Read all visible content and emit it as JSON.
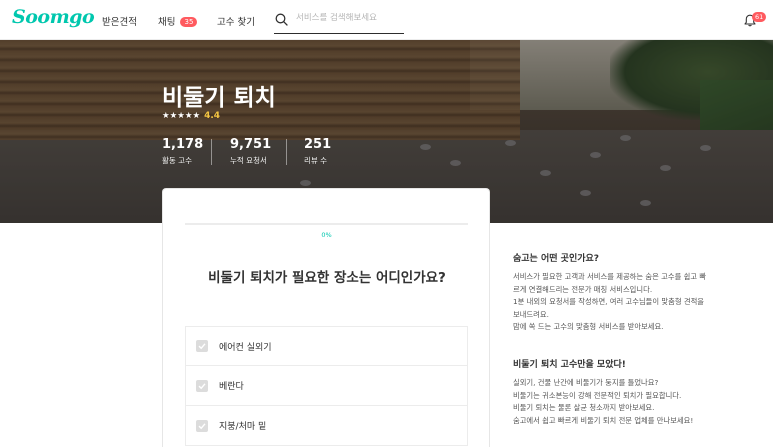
{
  "header": {
    "logo": "Soomgo",
    "nav": [
      {
        "label": "받은견적"
      },
      {
        "label": "채팅",
        "badge": "35"
      },
      {
        "label": "고수 찾기"
      }
    ],
    "search_placeholder": "서비스를 검색해보세요",
    "notification_badge": "61"
  },
  "hero": {
    "title": "비둘기 퇴치",
    "stars": "★★★★★",
    "rating": "4.4",
    "stats": [
      {
        "value": "1,178",
        "label": "활동 고수"
      },
      {
        "value": "9,751",
        "label": "누적 요청서"
      },
      {
        "value": "251",
        "label": "리뷰 수"
      }
    ]
  },
  "questionnaire": {
    "progress": 0,
    "progress_label": "0%",
    "question": "비둘기 퇴치가 필요한 장소는 어디인가요?",
    "options": [
      {
        "label": "에어컨 실외기"
      },
      {
        "label": "베란다"
      },
      {
        "label": "지붕/처마 밑"
      }
    ]
  },
  "info": {
    "section1": {
      "title": "숨고는 어떤 곳인가요?",
      "lines": [
        "서비스가 필요한 고객과 서비스를 제공하는 숨은 고수를 쉽고 빠",
        "르게 연결해드리는 전문가 매칭 서비스입니다.",
        "1분 내외의 요청서를 작성하면, 여러 고수님들이 맞춤형 견적을",
        "보내드려요.",
        "맘에 쏙 드는 고수의 맞춤형 서비스를 받아보세요."
      ]
    },
    "section2": {
      "title": "비둘기 퇴치 고수만을 모았다!",
      "lines": [
        "실외기, 건물 난간에 비둘기가 둥지를 틀었나요?",
        "비둘기는 귀소본능이 강해 전문적인 퇴치가 필요합니다.",
        "비둘기 퇴치는 물론 살균 청소까지 받아보세요.",
        "숨고에서 쉽고 빠르게 비둘기 퇴치 전문 업체를 만나보세요!"
      ]
    }
  },
  "colors": {
    "brand": "#00c7ae",
    "badge": "#ff5a5f",
    "star": "#f4c542"
  }
}
